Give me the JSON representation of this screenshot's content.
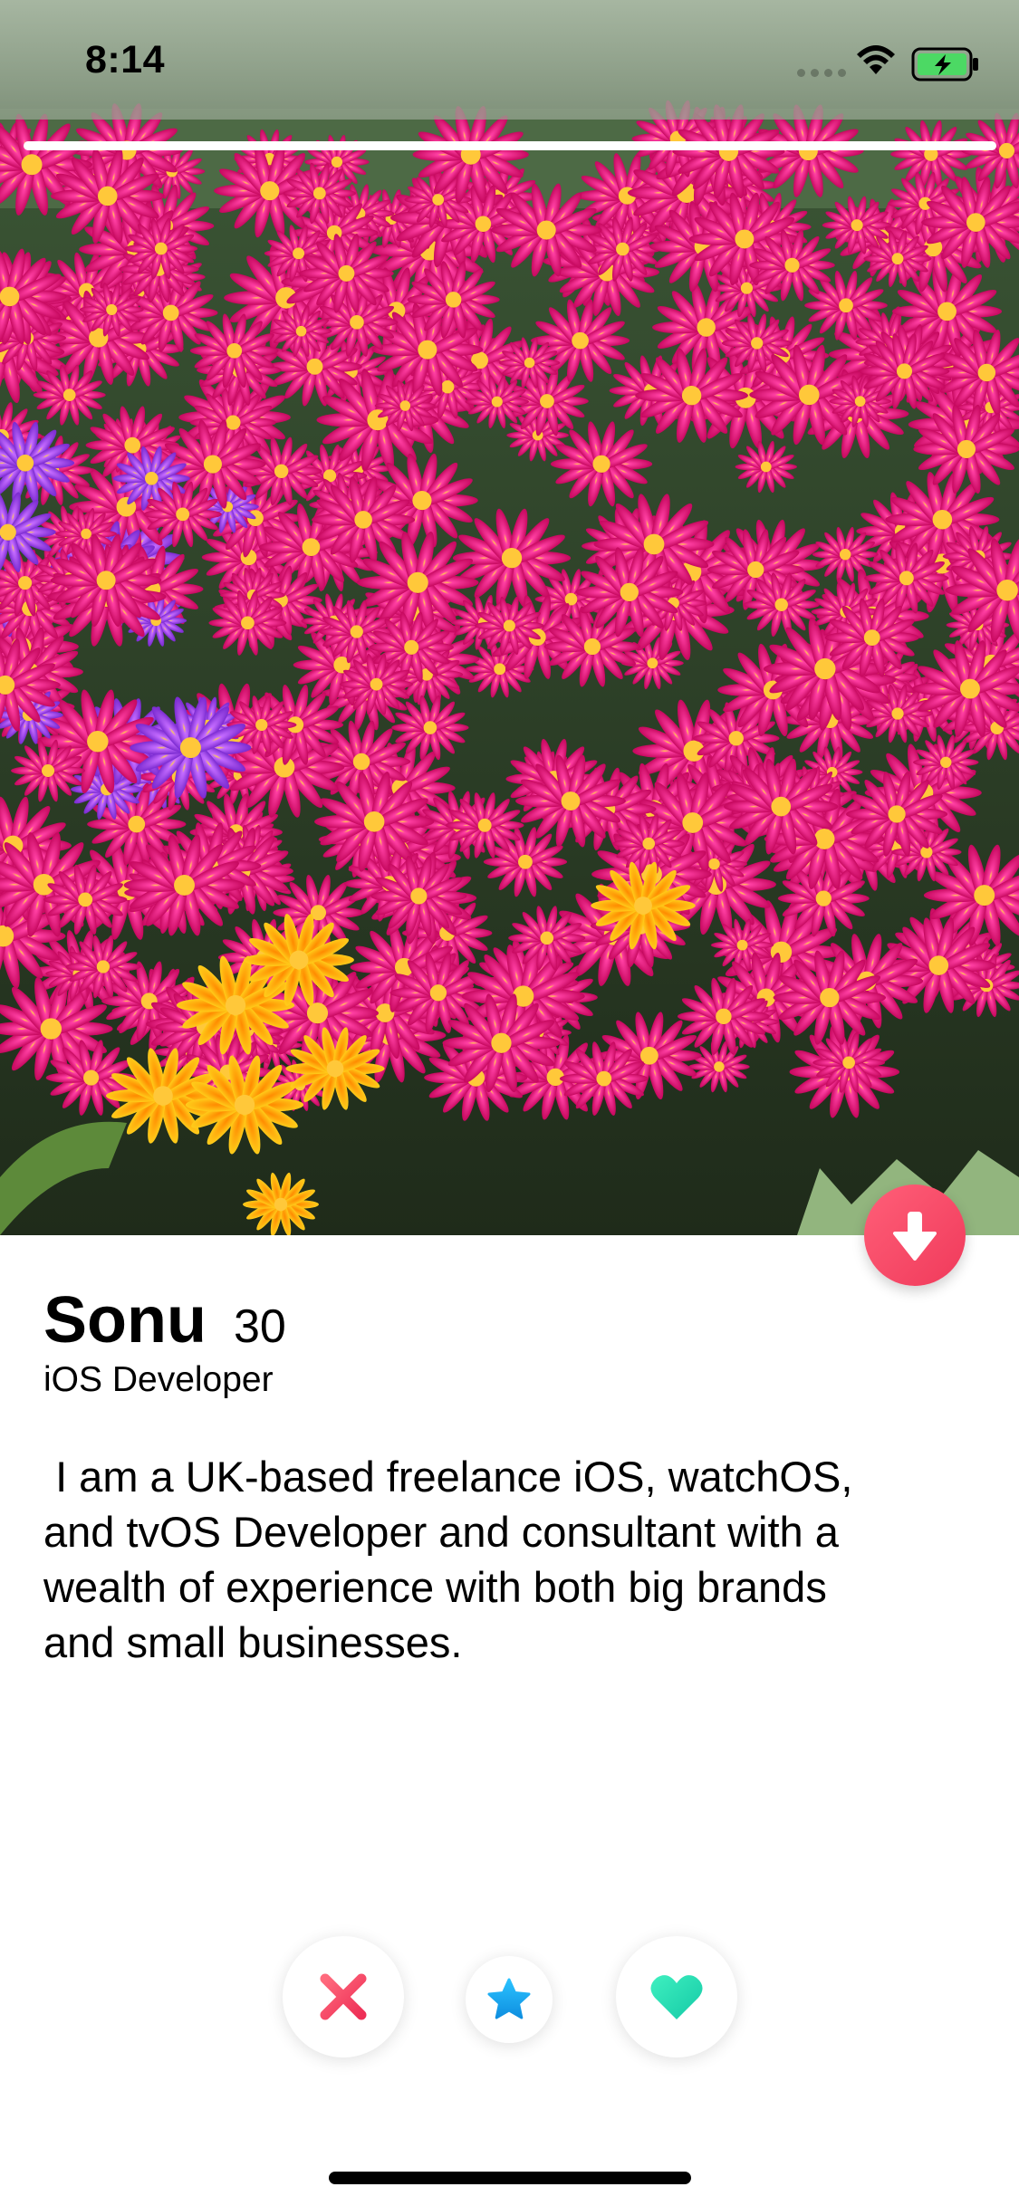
{
  "status_bar": {
    "time": "8:14",
    "icons": [
      "signal-dots-icon",
      "wifi-icon",
      "battery-charging-icon"
    ],
    "battery_color": "#4cd964"
  },
  "photo": {
    "description_icon": "flower-field-photo",
    "progress": 1.0
  },
  "profile": {
    "name": "Sonu",
    "age": "30",
    "job": "iOS Developer",
    "bio": " I am a UK-based freelance iOS, watchOS,\nand tvOS Developer and consultant with a\nwealth of experience with both big brands\nand small businesses."
  },
  "actions": {
    "collapse_icon": "arrow-down-icon",
    "nope_icon": "close-icon",
    "super_like_icon": "star-icon",
    "like_icon": "heart-icon"
  },
  "colors": {
    "accent_red": "#f03a5b",
    "star_blue": "#1aa5ec",
    "like_teal": "#2ed8b6"
  }
}
